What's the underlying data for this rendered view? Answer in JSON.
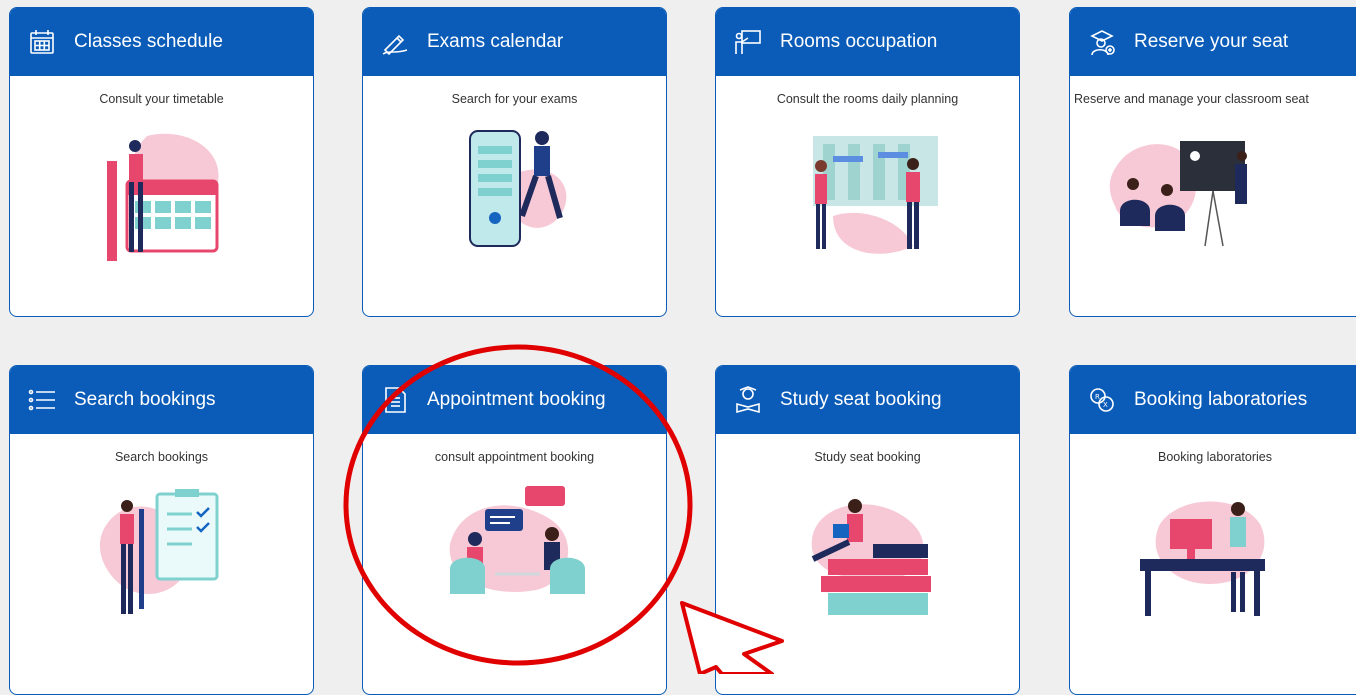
{
  "cards": [
    {
      "title": "Classes schedule",
      "description": "Consult your timetable",
      "icon": "calendar-icon"
    },
    {
      "title": "Exams calendar",
      "description": "Search for your exams",
      "icon": "pen-writing-icon"
    },
    {
      "title": "Rooms occupation",
      "description": "Consult the rooms daily planning",
      "icon": "presentation-board-icon"
    },
    {
      "title": "Reserve your seat",
      "description": "Reserve and manage your classroom seat",
      "icon": "student-add-icon"
    },
    {
      "title": "Search bookings",
      "description": "Search bookings",
      "icon": "list-icon"
    },
    {
      "title": "Appointment booking",
      "description": "consult appointment booking",
      "icon": "document-icon"
    },
    {
      "title": "Study seat booking",
      "description": "Study seat booking",
      "icon": "study-person-icon"
    },
    {
      "title": "Booking laboratories",
      "description": "Booking laboratories",
      "icon": "translate-icon"
    }
  ],
  "colors": {
    "header": "#0a5cb8",
    "highlight": "#e00000",
    "background": "#efefef"
  }
}
